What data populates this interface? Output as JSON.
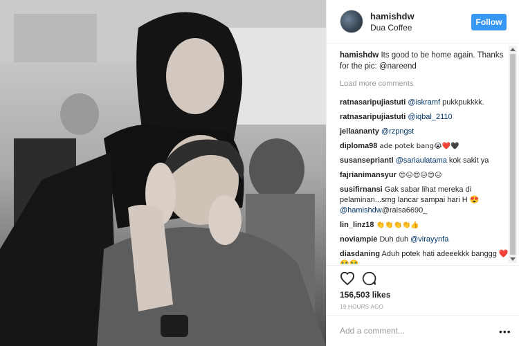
{
  "post": {
    "username": "hamishdw",
    "location": "Dua Coffee",
    "follow_label": "Follow",
    "caption_user": "hamishdw",
    "caption_text": "Its good to be home again. Thanks for the pic:",
    "caption_mention": "@nareend"
  },
  "load_more": "Load more comments",
  "comments": [
    {
      "user": "ratnasaripujiastuti",
      "mention": "@iskramf",
      "text": "pukkpukkkk."
    },
    {
      "user": "ratnasaripujiastuti",
      "mention": "@iqbal_2110",
      "text": ""
    },
    {
      "user": "jellaananty",
      "mention": "@rzpngst",
      "text": ""
    },
    {
      "user": "diploma98",
      "mention": "",
      "text": "ade potek bang😭❤️🖤"
    },
    {
      "user": "susansepriantl",
      "mention": "@sariaulatama",
      "text": "kok sakit ya"
    },
    {
      "user": "fajrianimansyur",
      "mention": "",
      "text": "😍😑😍😑😍😑"
    },
    {
      "user": "susifirnansi",
      "mention": "",
      "text": "Gak sabar lihat mereka di pelaminan...smg lancar sampai hari H 😍",
      "mention2": "@hamishdw",
      "text2": "@raisa6690_"
    },
    {
      "user": "lin_linz18",
      "mention": "",
      "text": "👏👏👏👏👍"
    },
    {
      "user": "noviampie",
      "mention": "",
      "text": "Duh duh",
      "mention2": "@virayynfa",
      "text2": ""
    },
    {
      "user": "diasdaning",
      "mention": "",
      "text": "Aduh potek hati adeeekkk banggg ❤️ 😭😭"
    }
  ],
  "likes": "156,503 likes",
  "time": "19 HOURS AGO",
  "add_comment_placeholder": "Add a comment...",
  "more_label": "•••",
  "colors": {
    "follow_button": "#3897f0",
    "link": "#003569",
    "muted": "#999999",
    "text": "#262626"
  }
}
